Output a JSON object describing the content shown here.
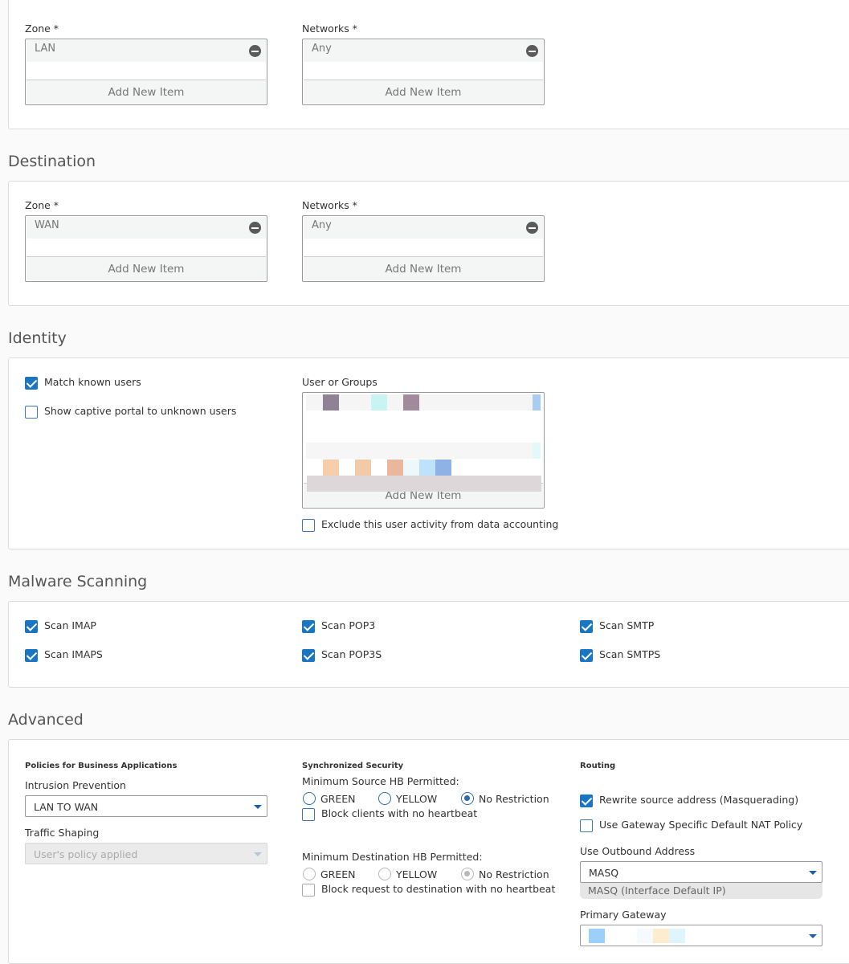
{
  "source": {
    "zone_label": "Zone *",
    "zone_value": "LAN",
    "networks_label": "Networks *",
    "networks_value": "Any",
    "add_item": "Add New Item"
  },
  "destination": {
    "title": "Destination",
    "zone_label": "Zone *",
    "zone_value": "WAN",
    "networks_label": "Networks *",
    "networks_value": "Any",
    "add_item": "Add New Item"
  },
  "identity": {
    "title": "Identity",
    "match_known_users": "Match known users",
    "show_captive_portal": "Show captive portal to unknown users",
    "users_groups_label": "User or Groups",
    "add_item": "Add New Item",
    "exclude_activity": "Exclude this user activity from data accounting"
  },
  "malware": {
    "title": "Malware Scanning",
    "items": [
      "Scan IMAP",
      "Scan IMAPS",
      "Scan POP3",
      "Scan POP3S",
      "Scan SMTP",
      "Scan SMTPS"
    ]
  },
  "advanced": {
    "title": "Advanced",
    "policies_heading": "Policies for Business Applications",
    "intrusion_label": "Intrusion Prevention",
    "intrusion_value": "LAN TO WAN",
    "traffic_label": "Traffic Shaping",
    "traffic_value": "User's policy applied",
    "sync_heading": "Synchronized Security",
    "min_source_label": "Minimum Source HB Permitted:",
    "min_dest_label": "Minimum Destination HB Permitted:",
    "hb_options": [
      "GREEN",
      "YELLOW",
      "No Restriction"
    ],
    "block_clients": "Block clients with no heartbeat",
    "block_request": "Block request to destination with no heartbeat",
    "routing_heading": "Routing",
    "rewrite_source": "Rewrite source address (Masquerading)",
    "gateway_nat": "Use Gateway Specific Default NAT Policy",
    "outbound_label": "Use Outbound Address",
    "outbound_value": "MASQ",
    "outbound_hint": "MASQ (Interface Default IP)",
    "primary_gateway_label": "Primary Gateway"
  },
  "colors": {
    "checkbox_blue": "#1976c2",
    "radio_blue": "#2b6bb0",
    "panel_border": "#dcdcdc"
  }
}
